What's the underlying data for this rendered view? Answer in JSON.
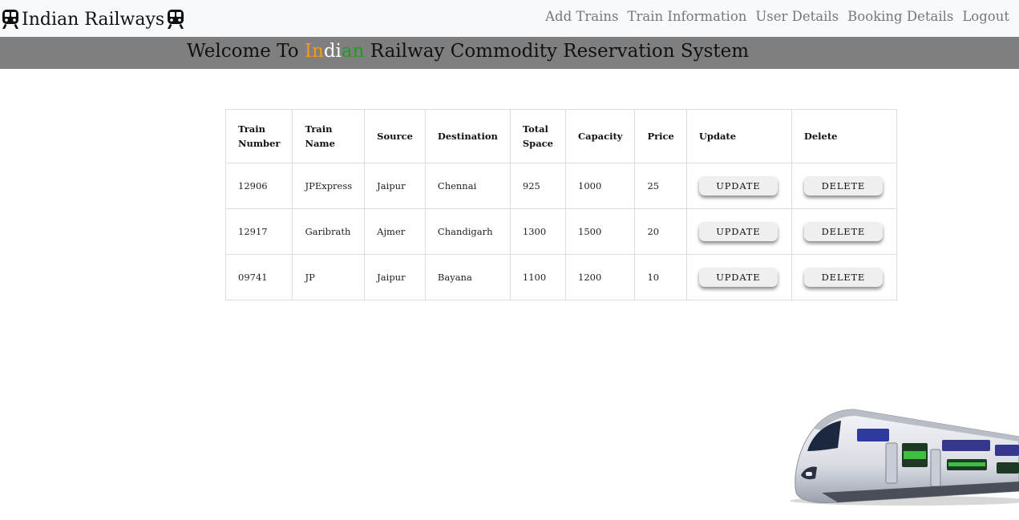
{
  "navbar": {
    "brand": "Indian Railways",
    "links": [
      "Add Trains",
      "Train Information",
      "User Details",
      "Booking Details",
      "Logout"
    ]
  },
  "welcome": {
    "prefix": "Welcome To ",
    "indian_parts": [
      "In",
      "di",
      "an"
    ],
    "suffix": " Railway Commodity Reservation System",
    "colors": {
      "saffron": "#f39c1b",
      "white": "#ffffff",
      "green": "#1f9d1f",
      "band": "#7f7f7f"
    }
  },
  "table": {
    "headers": [
      "Train Number",
      "Train Name",
      "Source",
      "Destination",
      "Total Space",
      "Capacity",
      "Price",
      "Update",
      "Delete"
    ],
    "rows": [
      {
        "number": "12906",
        "name": "JPExpress",
        "source": "Jaipur",
        "destination": "Chennai",
        "total_space": "925",
        "capacity": "1000",
        "price": "25",
        "update": "UPDATE",
        "delete": "DELETE"
      },
      {
        "number": "12917",
        "name": "Garibrath",
        "source": "Ajmer",
        "destination": "Chandigarh",
        "total_space": "1300",
        "capacity": "1500",
        "price": "20",
        "update": "UPDATE",
        "delete": "DELETE"
      },
      {
        "number": "09741",
        "name": "JP",
        "source": "Jaipur",
        "destination": "Bayana",
        "total_space": "1100",
        "capacity": "1200",
        "price": "10",
        "update": "UPDATE",
        "delete": "DELETE"
      }
    ]
  },
  "icons": {
    "brand_left": "train-icon",
    "brand_right": "train-icon",
    "footer_image": "train-graphic"
  }
}
